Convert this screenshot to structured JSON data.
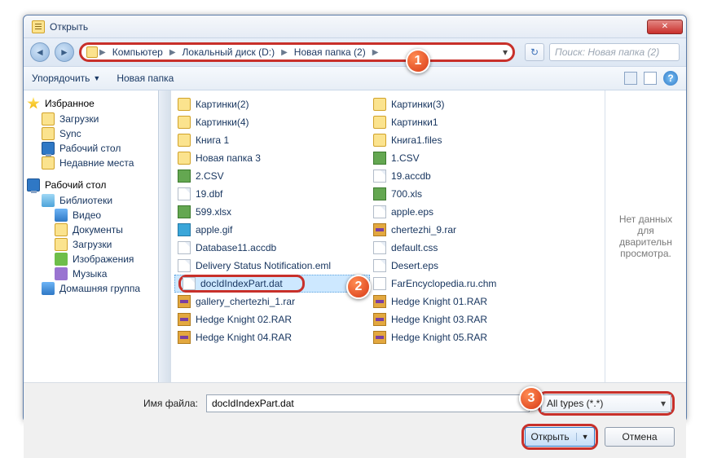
{
  "window": {
    "title": "Открыть"
  },
  "address": {
    "crumbs": [
      "Компьютер",
      "Локальный диск (D:)",
      "Новая папка (2)"
    ],
    "search_placeholder": "Поиск: Новая папка (2)"
  },
  "toolbar": {
    "organize": "Упорядочить",
    "newfolder": "Новая папка"
  },
  "nav": {
    "fav_hdr": "Избранное",
    "fav_items": [
      "Загрузки",
      "Sync",
      "Рабочий стол",
      "Недавние места"
    ],
    "desktop_hdr": "Рабочий стол",
    "lib_hdr": "Библиотеки",
    "lib_items": [
      "Видео",
      "Документы",
      "Загрузки",
      "Изображения",
      "Музыка"
    ],
    "homegroup": "Домашняя группа"
  },
  "files": {
    "col1": [
      {
        "n": "Картинки(2)",
        "t": "fold"
      },
      {
        "n": "Картинки(4)",
        "t": "fold"
      },
      {
        "n": "Книга 1",
        "t": "fold"
      },
      {
        "n": "Новая папка 3",
        "t": "fold"
      },
      {
        "n": "2.CSV",
        "t": "xls"
      },
      {
        "n": "19.dbf",
        "t": "gen"
      },
      {
        "n": "599.xlsx",
        "t": "xls"
      },
      {
        "n": "apple.gif",
        "t": "gif"
      },
      {
        "n": "Database11.accdb",
        "t": "gen"
      },
      {
        "n": "Delivery Status Notification.eml",
        "t": "gen"
      },
      {
        "n": "docIdIndexPart.dat",
        "t": "gen",
        "sel": true
      },
      {
        "n": "gallery_chertezhi_1.rar",
        "t": "rar"
      },
      {
        "n": "Hedge Knight 02.RAR",
        "t": "rar"
      },
      {
        "n": "Hedge Knight 04.RAR",
        "t": "rar"
      }
    ],
    "col2": [
      {
        "n": "Картинки(3)",
        "t": "fold"
      },
      {
        "n": "Картинки1",
        "t": "fold"
      },
      {
        "n": "Книга1.files",
        "t": "fold"
      },
      {
        "n": "1.CSV",
        "t": "xls"
      },
      {
        "n": "19.accdb",
        "t": "gen"
      },
      {
        "n": "700.xls",
        "t": "xls"
      },
      {
        "n": "apple.eps",
        "t": "gen"
      },
      {
        "n": "chertezhi_9.rar",
        "t": "rar"
      },
      {
        "n": "default.css",
        "t": "gen"
      },
      {
        "n": "Desert.eps",
        "t": "gen"
      },
      {
        "n": "FarEncyclopedia.ru.chm",
        "t": "chm"
      },
      {
        "n": "Hedge Knight 01.RAR",
        "t": "rar"
      },
      {
        "n": "Hedge Knight 03.RAR",
        "t": "rar"
      },
      {
        "n": "Hedge Knight 05.RAR",
        "t": "rar"
      }
    ]
  },
  "preview": {
    "text": "Нет данных для дварительн просмотра."
  },
  "footer": {
    "filename_label": "Имя файла:",
    "filename_value": "docIdIndexPart.dat",
    "filter": "All types (*.*)",
    "open": "Открыть",
    "cancel": "Отмена"
  },
  "badges": {
    "b1": "1",
    "b2": "2",
    "b3": "3"
  }
}
